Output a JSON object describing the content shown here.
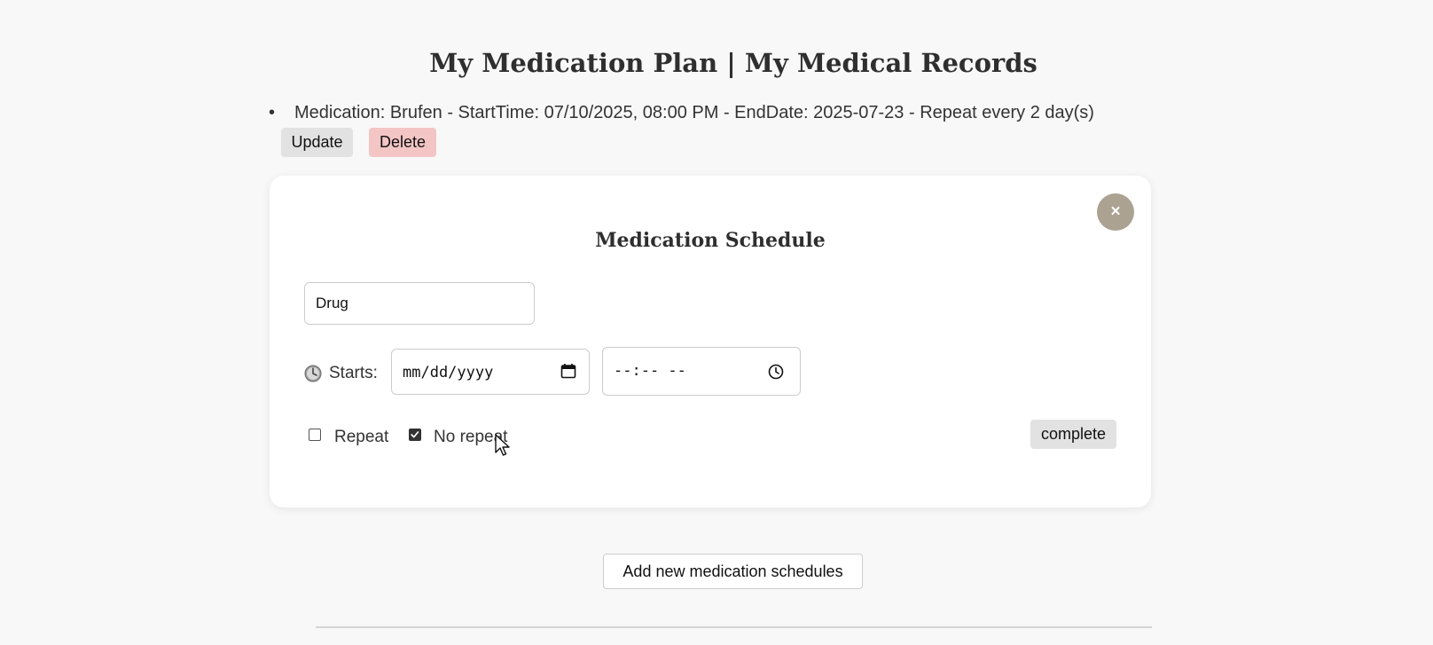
{
  "page": {
    "title": "My Medication Plan | My Medical Records"
  },
  "medications": [
    {
      "bullet": "•",
      "text": "Medication: Brufen - StartTime: 07/10/2025, 08:00 PM - EndDate: 2025-07-23 - Repeat every 2 day(s)",
      "update_label": "Update",
      "delete_label": "Delete"
    }
  ],
  "modal": {
    "close_label": "×",
    "title": "Medication Schedule",
    "drug_value": "Drug",
    "starts_label": "Starts:",
    "date_placeholder": "mm/dd/yyyy",
    "time_placeholder": "--:-- --",
    "repeat_label": "Repeat",
    "repeat_checked": false,
    "no_repeat_label": "No repeat",
    "no_repeat_checked": true,
    "complete_label": "complete"
  },
  "add_button_label": "Add new medication schedules",
  "icons": {
    "clock": "clock-icon",
    "calendar": "calendar-icon",
    "time": "time-icon",
    "close": "close-icon",
    "check": "check-icon",
    "cursor": "mouse-cursor"
  },
  "colors": {
    "background": "#f8f8f8",
    "delete_bg": "#f4c5c5",
    "close_bg": "#aca291",
    "neutral_btn_bg": "#e2e2e2"
  }
}
